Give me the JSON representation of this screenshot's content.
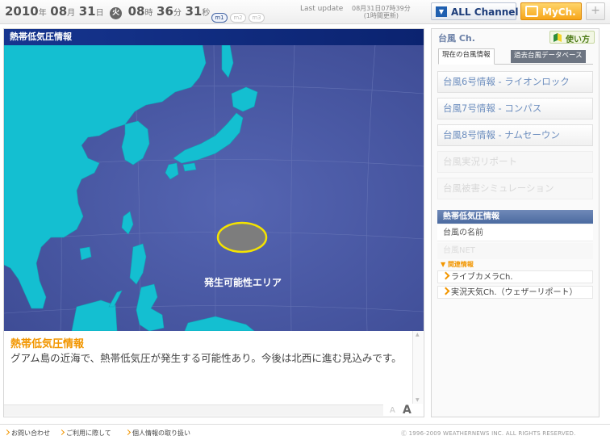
{
  "header": {
    "clock": {
      "year": "2010",
      "year_unit": "年",
      "month": "08",
      "month_unit": "月",
      "day": "31",
      "day_unit": "日",
      "weekday": "火",
      "hour": "08",
      "hour_unit": "時",
      "minute": "36",
      "minute_unit": "分",
      "second": "31",
      "second_unit": "秒"
    },
    "mode_tabs": [
      "m1",
      "m2",
      "m3"
    ],
    "last_update_label": "Last update",
    "last_update_time": "08月31日07時39分",
    "last_update_note": "(1時間更新)",
    "all_channel_label": "ALL Channel",
    "mych_label": "MyCh.",
    "add_label": "+"
  },
  "main": {
    "title": "熱帯低気圧情報",
    "map_label": "発生可能性エリア",
    "colors": {
      "sea": "#4a5aa6",
      "land": "#14bfd1",
      "area_fill": "#7d7d7d",
      "area_border": "#f4e300"
    },
    "description_title": "熱帯低気圧情報",
    "description_text": "グアム島の近海で、熱帯低気圧が発生する可能性あり。今後は北西に進む見込みです。",
    "font_small": "A",
    "font_large": "A"
  },
  "sidebar": {
    "title": "台風 Ch.",
    "usage_label": "使い方",
    "tabs": {
      "current": "現在の台風情報",
      "past": "過去台風データベース"
    },
    "typhoons": [
      {
        "label": "台風6号情報 - ライオンロック",
        "enabled": true
      },
      {
        "label": "台風7号情報 - コンパス",
        "enabled": true
      },
      {
        "label": "台風8号情報 - ナムセーウン",
        "enabled": true
      },
      {
        "label": "台風実況リポート",
        "enabled": false
      },
      {
        "label": "台風被害シミュレーション",
        "enabled": false
      }
    ],
    "section_title": "熱帯低気圧情報",
    "typhoon_name": "台風の名前",
    "typhoon_net": "台風NET",
    "related_title": "関連情報",
    "related": [
      "ライブカメラCh.",
      "実況天気Ch.（ウェザーリポート）"
    ]
  },
  "footer": {
    "links": [
      "お問い合わせ",
      "ご利用に際して",
      "個人情報の取り扱い"
    ],
    "copyright": "Ⓒ 1996-2009 WEATHERNEWS INC. ALL RIGHTS RESERVED."
  }
}
